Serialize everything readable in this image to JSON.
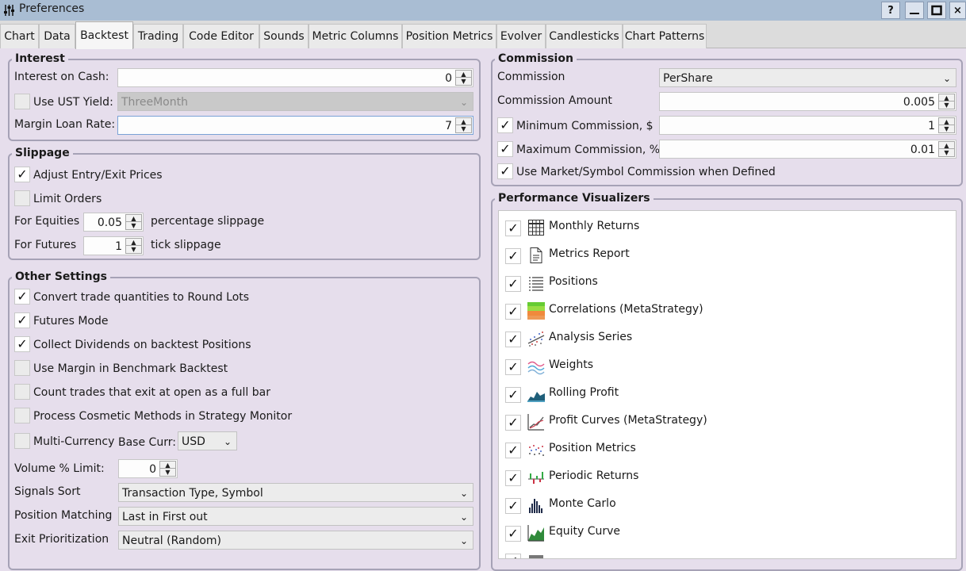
{
  "window": {
    "title": "Preferences",
    "controls": [
      "?",
      "—",
      "■",
      "×"
    ]
  },
  "tabs": [
    "Chart",
    "Data",
    "Backtest",
    "Trading",
    "Code Editor",
    "Sounds",
    "Metric Columns",
    "Position Metrics",
    "Evolver",
    "Candlesticks",
    "Chart Patterns"
  ],
  "active_tab": "Backtest",
  "interest": {
    "title": "Interest",
    "cash_label": "Interest on Cash:",
    "cash_value": "0",
    "ust_label": "Use UST Yield:",
    "ust_checked": false,
    "ust_value": "ThreeMonth",
    "margin_label": "Margin Loan Rate:",
    "margin_value": "7"
  },
  "slippage": {
    "title": "Slippage",
    "adjust_label": "Adjust Entry/Exit Prices",
    "adjust_checked": true,
    "limit_label": "Limit Orders",
    "limit_checked": false,
    "equities_label": "For Equities",
    "equities_value": "0.05",
    "equities_suffix": "percentage slippage",
    "futures_label": "For Futures",
    "futures_value": "1",
    "futures_suffix": "tick slippage"
  },
  "other": {
    "title": "Other Settings",
    "options": [
      {
        "label": "Convert trade quantities to Round Lots",
        "checked": true
      },
      {
        "label": "Futures Mode",
        "checked": true
      },
      {
        "label": "Collect Dividends on backtest Positions",
        "checked": true
      },
      {
        "label": "Use Margin in Benchmark Backtest",
        "checked": false
      },
      {
        "label": "Count trades that exit at open as a full bar",
        "checked": false
      },
      {
        "label": "Process Cosmetic Methods in Strategy Monitor",
        "checked": false
      }
    ],
    "multicurrency_label": "Multi-Currency",
    "multicurrency_checked": false,
    "base_curr_label": "Base Curr:",
    "base_curr_value": "USD",
    "volume_label": "Volume % Limit:",
    "volume_value": "0",
    "signals_label": "Signals Sort",
    "signals_value": "Transaction Type, Symbol",
    "matching_label": "Position Matching",
    "matching_value": "Last in First out",
    "exit_label": "Exit Prioritization",
    "exit_value": "Neutral (Random)"
  },
  "commission": {
    "title": "Commission",
    "type_label": "Commission",
    "type_value": "PerShare",
    "amount_label": "Commission Amount",
    "amount_value": "0.005",
    "min_label": "Minimum Commission, $",
    "min_checked": true,
    "min_value": "1",
    "max_label": "Maximum Commission, %",
    "max_checked": true,
    "max_value": "0.01",
    "market_label": "Use Market/Symbol Commission when Defined",
    "market_checked": true
  },
  "visualizers": {
    "title": "Performance Visualizers",
    "items": [
      {
        "label": "Monthly Returns",
        "checked": true,
        "icon": "grid-table-icon"
      },
      {
        "label": "Metrics Report",
        "checked": true,
        "icon": "document-icon"
      },
      {
        "label": "Positions",
        "checked": true,
        "icon": "list-icon"
      },
      {
        "label": "Correlations (MetaStrategy)",
        "checked": true,
        "icon": "color-bands-icon"
      },
      {
        "label": "Analysis Series",
        "checked": true,
        "icon": "scatter-dots-icon"
      },
      {
        "label": "Weights",
        "checked": true,
        "icon": "wave-lines-icon"
      },
      {
        "label": "Rolling Profit",
        "checked": true,
        "icon": "area-profile-icon"
      },
      {
        "label": "Profit Curves (MetaStrategy)",
        "checked": true,
        "icon": "line-curve-icon"
      },
      {
        "label": "Position Metrics",
        "checked": true,
        "icon": "dot-cloud-icon"
      },
      {
        "label": "Periodic Returns",
        "checked": true,
        "icon": "red-green-bars-icon"
      },
      {
        "label": "Monte Carlo",
        "checked": true,
        "icon": "histogram-icon"
      },
      {
        "label": "Equity Curve",
        "checked": true,
        "icon": "green-area-icon"
      },
      {
        "label": "",
        "checked": true,
        "icon": "partial-row-icon"
      }
    ]
  },
  "colors": {
    "background": "#e6deec",
    "titlebar": "#a9bdd3",
    "group_border": "#a6a2b6"
  }
}
